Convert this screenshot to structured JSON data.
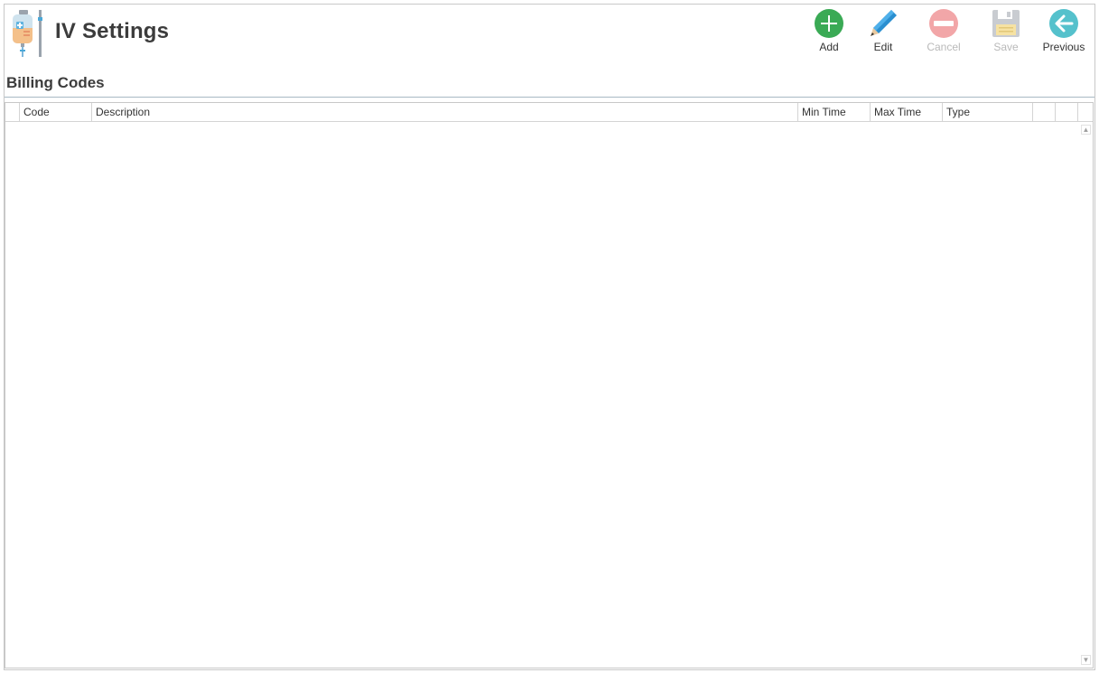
{
  "header": {
    "title": "IV Settings",
    "app_icon": "iv-bag-icon"
  },
  "toolbar": {
    "add_label": "Add",
    "edit_label": "Edit",
    "cancel_label": "Cancel",
    "save_label": "Save",
    "previous_label": "Previous",
    "cancel_disabled": true,
    "save_disabled": true,
    "colors": {
      "add": "#3aaa55",
      "edit": "#2a8fd0",
      "cancel": "#f2a6a8",
      "save": "#c9ccd1",
      "previous": "#55c1cc"
    }
  },
  "section": {
    "title": "Billing Codes"
  },
  "grid": {
    "columns": [
      "Code",
      "Description",
      "Min Time",
      "Max Time",
      "Type"
    ],
    "rows": []
  },
  "scrollbar": {
    "up_icon": "scroll-up-icon",
    "down_icon": "scroll-down-icon"
  }
}
